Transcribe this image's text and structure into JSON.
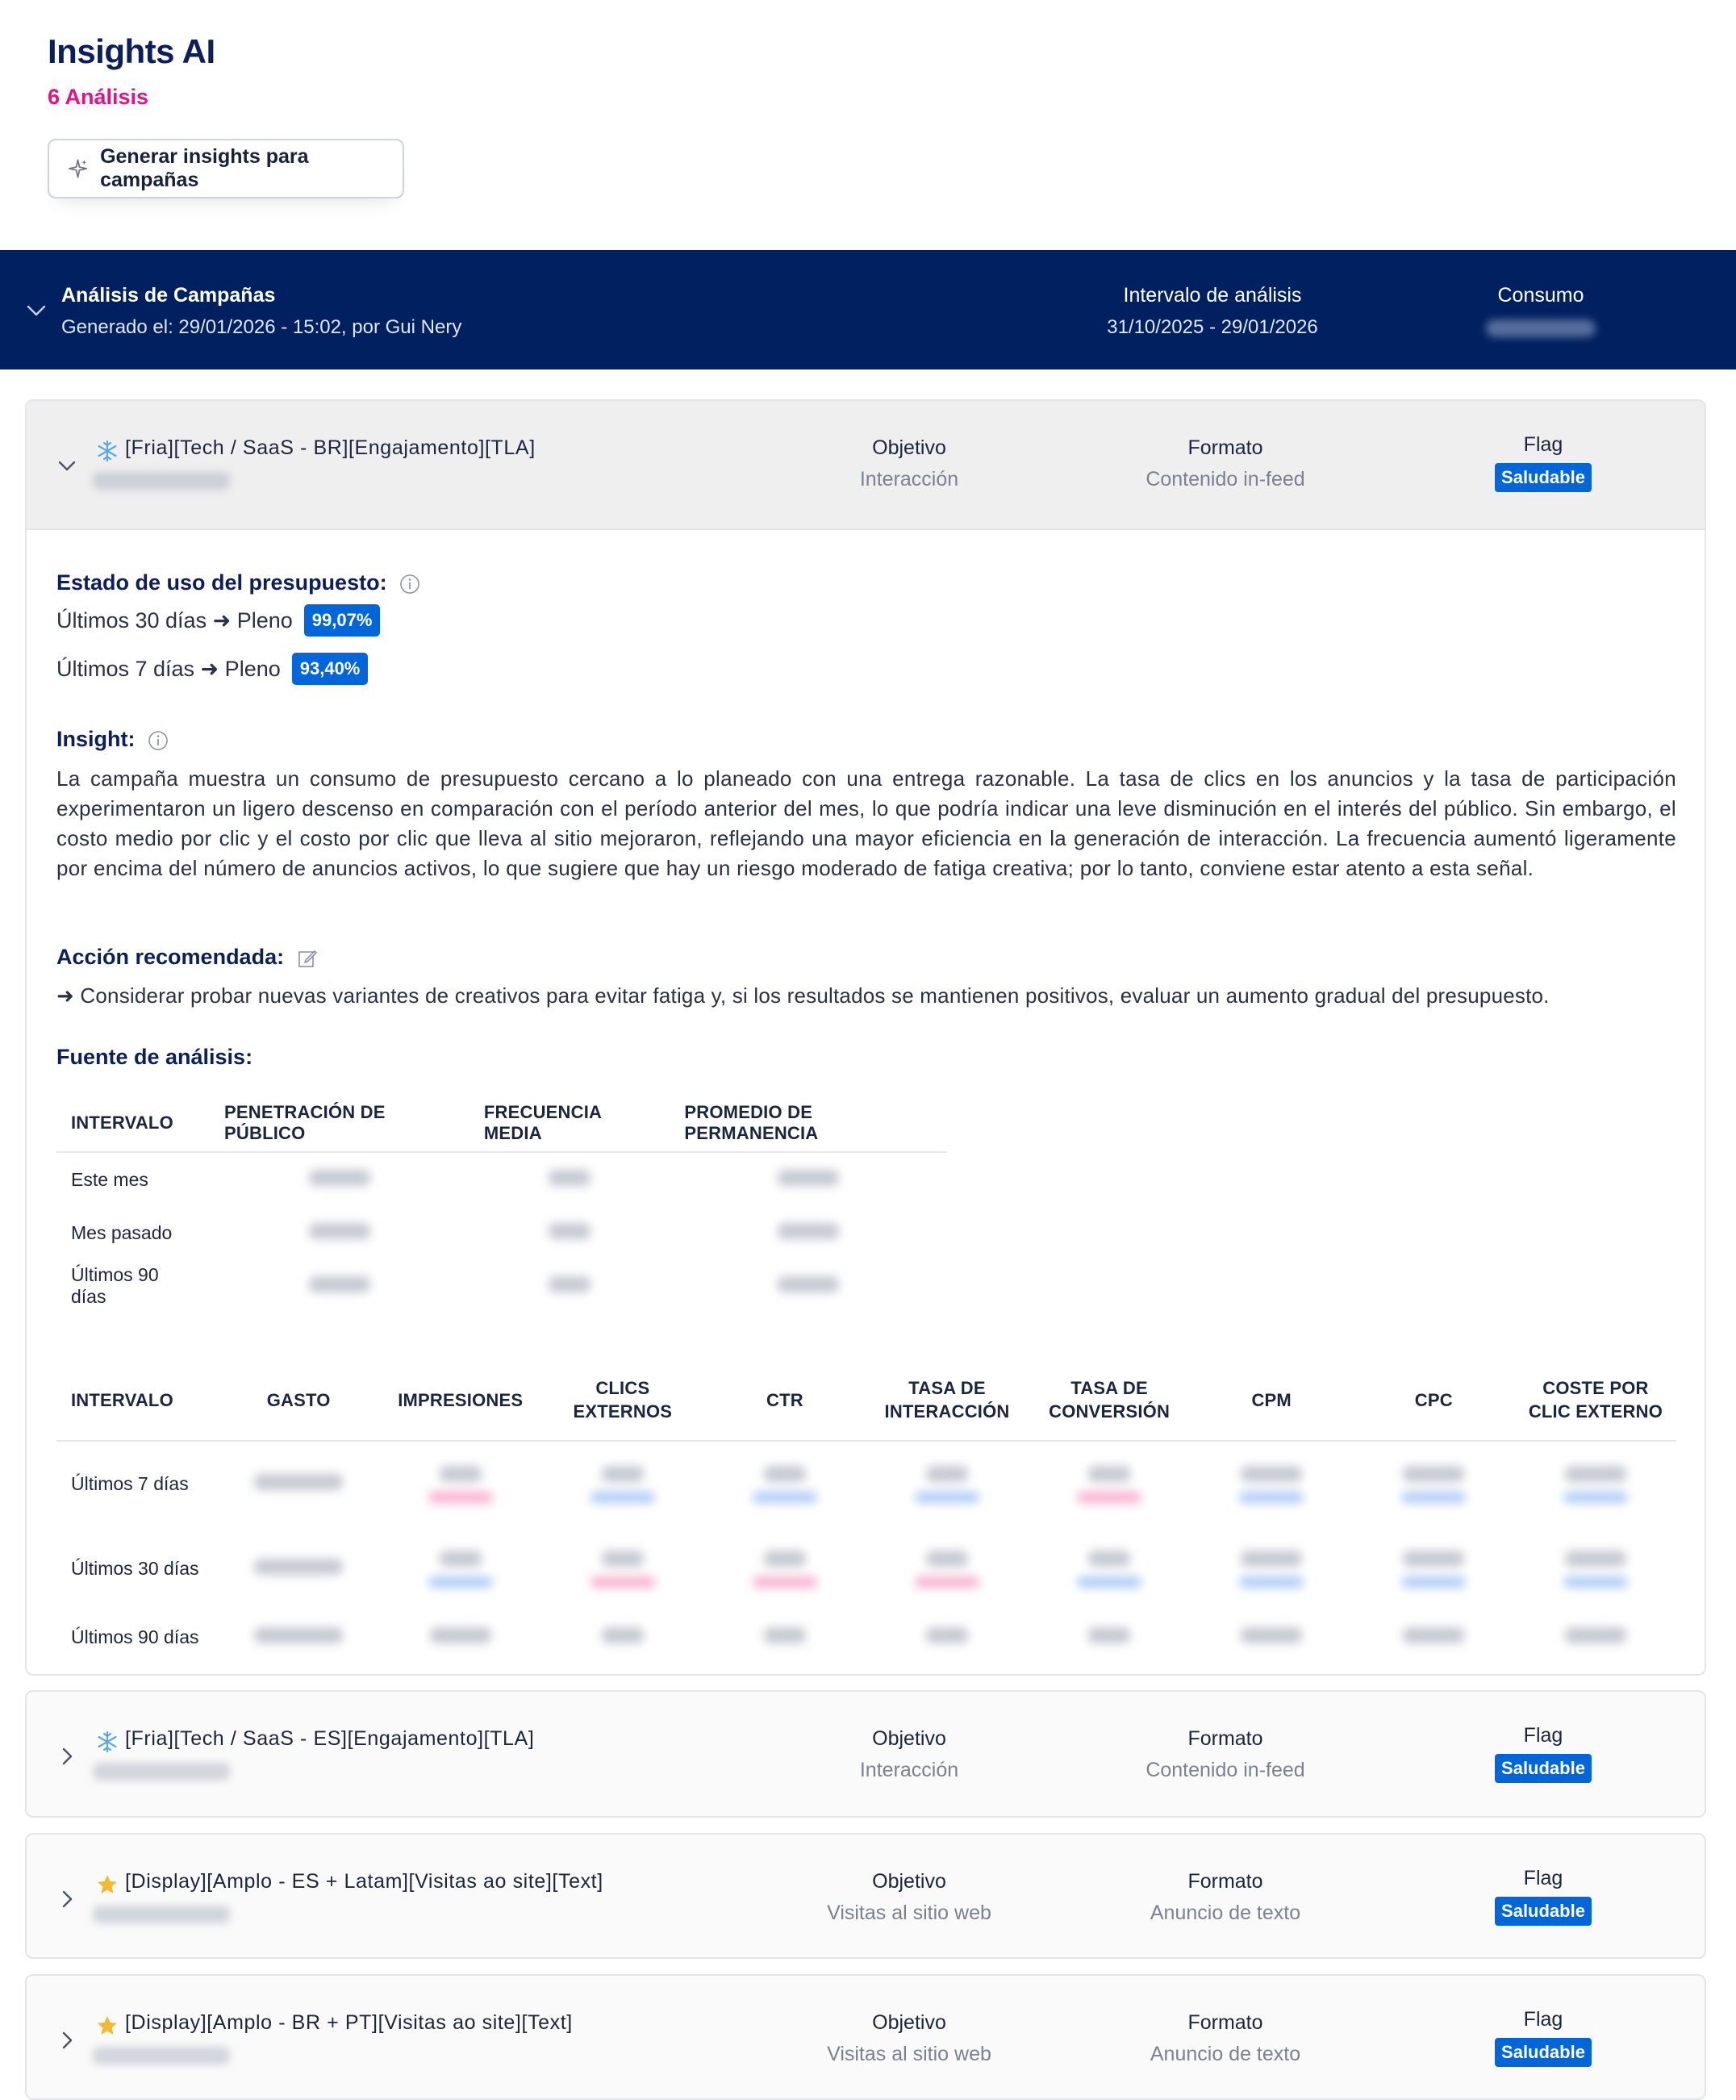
{
  "header": {
    "title": "Insights AI",
    "count": "6 Análisis",
    "generate_button": "Generar insights para campañas"
  },
  "banner": {
    "title": "Análisis de Campañas",
    "generated": "Generado el: 29/01/2026 - 15:02, por Gui Nery",
    "interval_label": "Intervalo de análisis",
    "interval_value": "31/10/2025 - 29/01/2026",
    "consumption_label": "Consumo"
  },
  "labels": {
    "objective": "Objetivo",
    "format": "Formato",
    "flag": "Flag"
  },
  "campaigns": [
    {
      "icon": "snowflake-icon",
      "name": "[Fria][Tech / SaaS - BR][Engajamento][TLA]",
      "objective": "Interacción",
      "format": "Contenido in-feed",
      "flag": "Saludable",
      "expanded": true
    },
    {
      "icon": "snowflake-icon",
      "name": "[Fria][Tech / SaaS - ES][Engajamento][TLA]",
      "objective": "Interacción",
      "format": "Contenido in-feed",
      "flag": "Saludable",
      "expanded": false
    },
    {
      "icon": "star-icon",
      "name": "[Display][Amplo - ES + Latam][Visitas ao site][Text]",
      "objective": "Visitas al sitio web",
      "format": "Anuncio de texto",
      "flag": "Saludable",
      "expanded": false
    },
    {
      "icon": "star-icon",
      "name": "[Display][Amplo - BR + PT][Visitas ao site][Text]",
      "objective": "Visitas al sitio web",
      "format": "Anuncio de texto",
      "flag": "Saludable",
      "expanded": false
    }
  ],
  "detail": {
    "budget_title": "Estado de uso del presupuesto:",
    "budget_30_label": "Últimos 30 días ➜ Pleno",
    "budget_30_value": "99,07%",
    "budget_7_label": "Últimos 7 días ➜ Pleno",
    "budget_7_value": "93,40%",
    "insight_title": "Insight:",
    "insight_text": "La campaña muestra un consumo de presupuesto cercano a lo planeado con una entrega razonable. La tasa de clics en los anuncios y la tasa de participación experimentaron un ligero descenso en comparación con el período anterior del mes, lo que podría indicar una leve disminución en el interés del público. Sin embargo, el costo medio por clic y el costo por clic que lleva al sitio mejoraron, reflejando una mayor eficiencia en la generación de interacción. La frecuencia aumentó ligeramente por encima del número de anuncios activos, lo que sugiere que hay un riesgo moderado de fatiga creativa; por lo tanto, conviene estar atento a esta señal.",
    "action_title": "Acción recomendada:",
    "action_text": "➜ Considerar probar nuevas variantes de creativos para evitar fatiga y, si los resultados se mantienen positivos, evaluar un aumento gradual del presupuesto.",
    "source_title": "Fuente de análisis:"
  },
  "table_audience": {
    "headers": [
      "INTERVALO",
      "PENETRACIÓN DE PÚBLICO",
      "FRECUENCIA MEDIA",
      "PROMEDIO DE PERMANENCIA"
    ],
    "rows": [
      "Este mes",
      "Mes pasado",
      "Últimos 90 días"
    ]
  },
  "table_metrics": {
    "headers": [
      "INTERVALO",
      "GASTO",
      "IMPRESIONES",
      "CLICS EXTERNOS",
      "CTR",
      "TASA DE INTERACCIÓN",
      "TASA DE CONVERSIÓN",
      "CPM",
      "CPC",
      "COSTE POR CLIC EXTERNO"
    ],
    "rows": [
      "Últimos 7 días",
      "Últimos 30 días",
      "Últimos 90 días"
    ]
  },
  "colors": {
    "navy": "#00205F",
    "brand_pink": "#E6108A",
    "badge_blue": "#0066D9"
  }
}
